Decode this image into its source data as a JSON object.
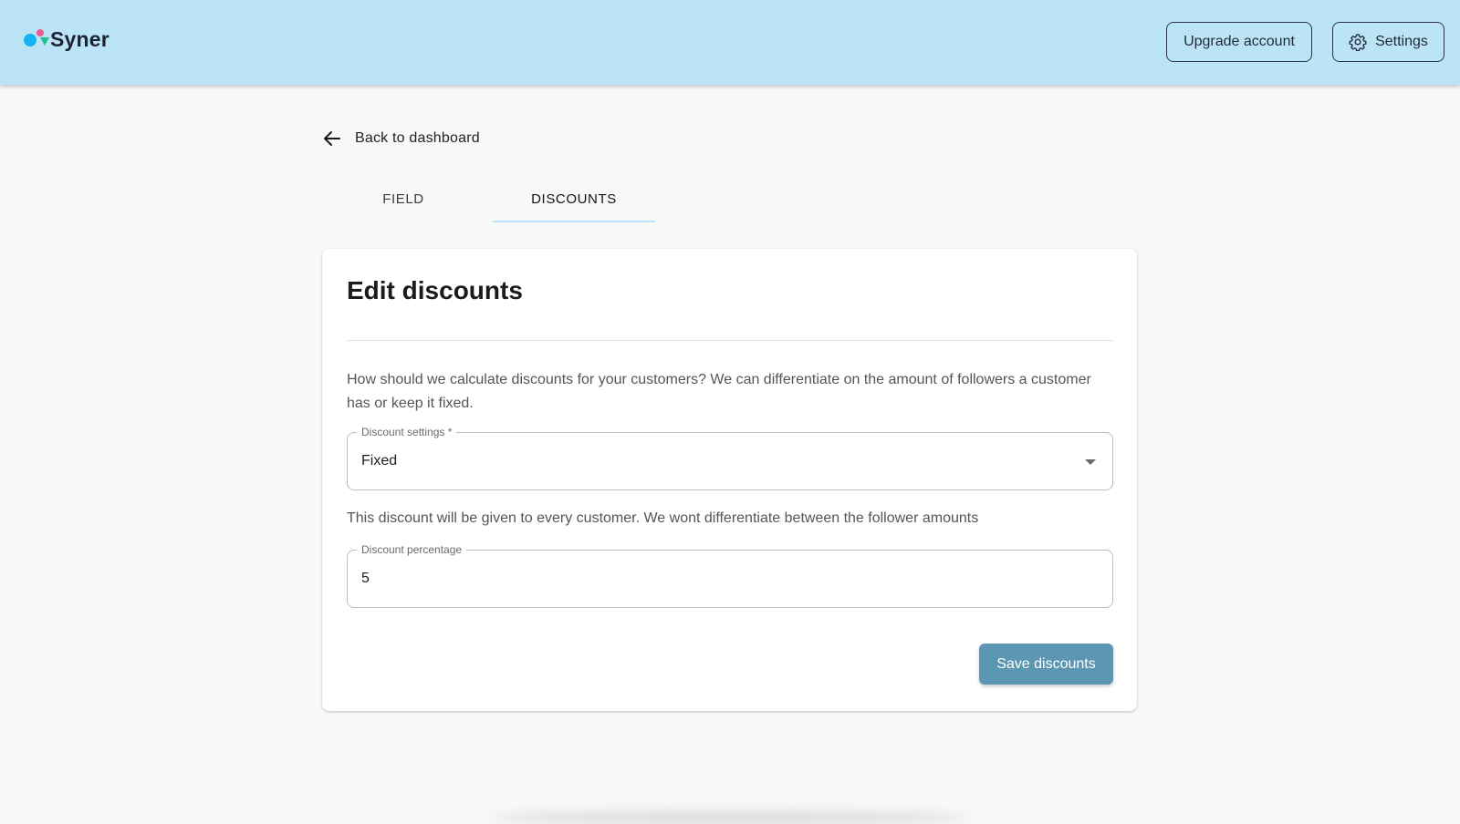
{
  "app": {
    "name": "Syner"
  },
  "header": {
    "upgrade_label": "Upgrade account",
    "settings_label": "Settings"
  },
  "nav": {
    "back_label": "Back to dashboard"
  },
  "tabs": [
    {
      "label": "FIELD",
      "active": false
    },
    {
      "label": "DISCOUNTS",
      "active": true
    }
  ],
  "card": {
    "title": "Edit discounts",
    "description": "How should we calculate discounts for your customers? We can differentiate on the amount of followers a customer has or keep it fixed.",
    "discount_settings": {
      "label": "Discount settings *",
      "value": "Fixed"
    },
    "hint": "This discount will be given to every customer. We wont differentiate between the follower amounts",
    "discount_percentage": {
      "label": "Discount percentage",
      "value": "5"
    },
    "save_label": "Save discounts"
  },
  "colors": {
    "header_bg": "#bce4f7",
    "primary_button": "#5b97b2",
    "tab_indicator": "#bce4f7"
  },
  "icons": {
    "logo": "syner-logo-icon",
    "settings": "gear-icon",
    "back": "arrow-left-icon",
    "select": "caret-down-icon"
  }
}
